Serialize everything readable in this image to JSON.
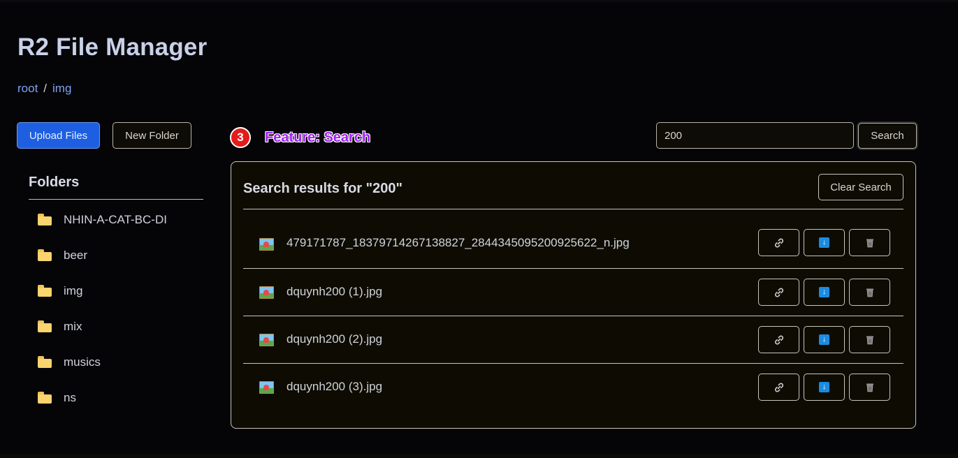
{
  "app": {
    "title": "R2 File Manager"
  },
  "breadcrumb": {
    "items": [
      "root",
      "img"
    ],
    "separator": "/"
  },
  "toolbar": {
    "upload_label": "Upload Files",
    "new_folder_label": "New Folder"
  },
  "feature": {
    "badge": "3",
    "label": "Feature: Search"
  },
  "search": {
    "value": "200",
    "button_label": "Search"
  },
  "sidebar": {
    "title": "Folders",
    "folders": [
      "NHIN-A-CAT-BC-DI",
      "beer",
      "img",
      "mix",
      "musics",
      "ns"
    ]
  },
  "results": {
    "title": "Search results for \"200\"",
    "clear_label": "Clear Search",
    "files": [
      {
        "name": "479171787_18379714267138827_2844345095200925622_n.jpg"
      },
      {
        "name": "dquynh200 (1).jpg"
      },
      {
        "name": "dquynh200 (2).jpg"
      },
      {
        "name": "dquynh200 (3).jpg"
      }
    ]
  },
  "colors": {
    "accent": "#1d5fe0",
    "link": "#7fa2ee",
    "badge": "#e31b1b",
    "feature_label": "#a020f0",
    "download_icon": "#1a8ce0"
  }
}
